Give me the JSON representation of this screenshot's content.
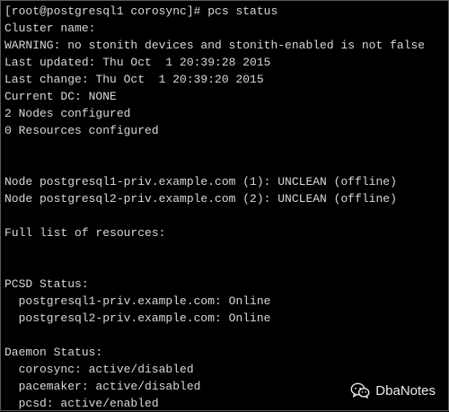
{
  "terminal": {
    "lines": [
      "[root@postgresql1 corosync]# pcs status",
      "Cluster name:",
      "WARNING: no stonith devices and stonith-enabled is not false",
      "Last updated: Thu Oct  1 20:39:28 2015",
      "Last change: Thu Oct  1 20:39:20 2015",
      "Current DC: NONE",
      "2 Nodes configured",
      "0 Resources configured",
      "",
      "",
      "Node postgresql1-priv.example.com (1): UNCLEAN (offline)",
      "Node postgresql2-priv.example.com (2): UNCLEAN (offline)",
      "",
      "Full list of resources:",
      "",
      "",
      "PCSD Status:",
      "  postgresql1-priv.example.com: Online",
      "  postgresql2-priv.example.com: Online",
      "",
      "Daemon Status:",
      "  corosync: active/disabled",
      "  pacemaker: active/disabled",
      "  pcsd: active/enabled"
    ]
  },
  "watermark": {
    "icon": "wechat-icon",
    "text": "DbaNotes"
  },
  "colors": {
    "background": "#000000",
    "text": "#d8d8d8"
  }
}
